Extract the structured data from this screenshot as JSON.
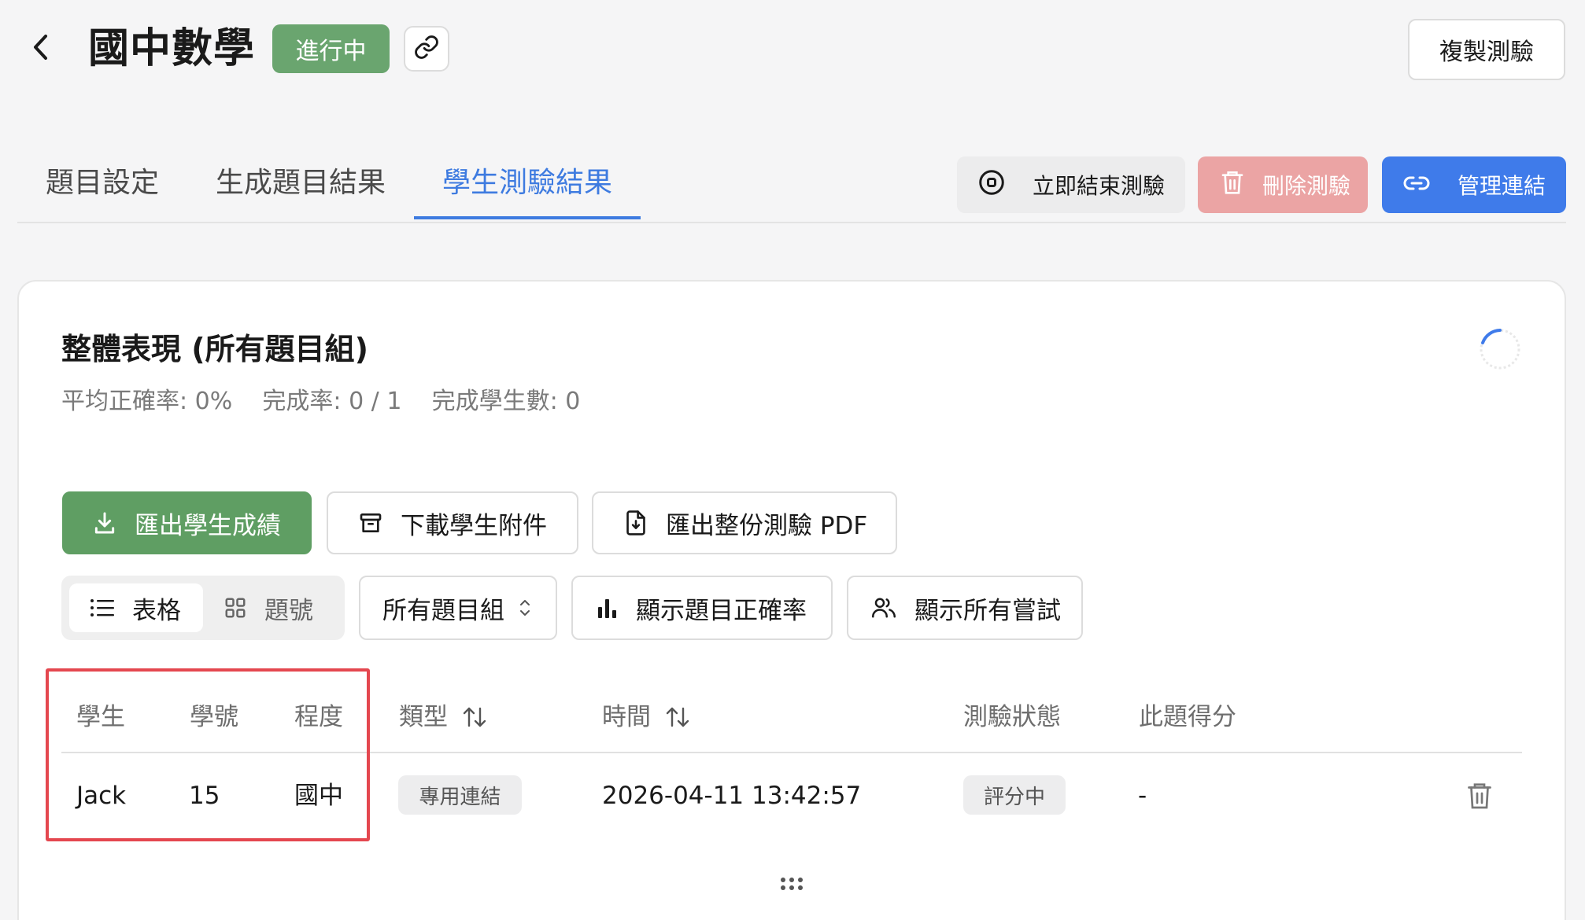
{
  "header": {
    "title": "國中數學",
    "status_badge": "進行中",
    "copy_button": "複製測驗"
  },
  "tabs": [
    {
      "label": "題目設定",
      "active": false
    },
    {
      "label": "生成題目結果",
      "active": false
    },
    {
      "label": "學生測驗結果",
      "active": true
    }
  ],
  "actions": {
    "end_now": "立即結束測驗",
    "delete": "刪除測驗",
    "manage_links": "管理連結"
  },
  "performance": {
    "title": "整體表現 (所有題目組)",
    "avg_label": "平均正確率:",
    "avg_value": "0%",
    "completion_label": "完成率:",
    "completion_value": "0 / 1",
    "completed_label": "完成學生數:",
    "completed_value": "0"
  },
  "toolbar": {
    "export_scores": "匯出學生成績",
    "download_attachments": "下載學生附件",
    "export_pdf": "匯出整份測驗 PDF",
    "view_table": "表格",
    "view_number": "題號",
    "group_select": "所有題目組",
    "show_accuracy": "顯示題目正確率",
    "show_all_attempts": "顯示所有嘗試"
  },
  "table": {
    "columns": [
      "學生",
      "學號",
      "程度",
      "類型",
      "時間",
      "測驗狀態",
      "此題得分"
    ],
    "rows": [
      {
        "student": "Jack",
        "student_id": "15",
        "level": "國中",
        "type": "專用連結",
        "time": "2026-04-11 13:42:57",
        "status": "評分中",
        "score": "-"
      }
    ]
  },
  "colors": {
    "accent_blue": "#3f7bea",
    "status_green": "#6aa56f",
    "export_green": "#5f9e63",
    "delete_red": "#eba4a4",
    "highlight_red": "#e4474f"
  },
  "icons": [
    "back-chevron-icon",
    "link-icon",
    "stop-circle-icon",
    "trash-icon",
    "chain-link-icon",
    "download-icon",
    "archive-icon",
    "file-download-icon",
    "list-icon",
    "grid-icon",
    "up-down-chevron-icon",
    "bar-chart-icon",
    "users-icon",
    "sort-arrows-icon",
    "spinner-icon",
    "drag-handle-icon"
  ]
}
